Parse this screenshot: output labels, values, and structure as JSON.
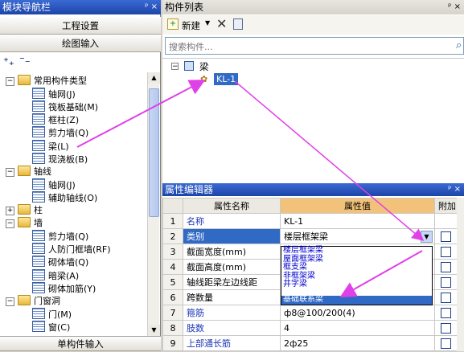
{
  "left_panel": {
    "title": "模块导航栏",
    "pin": "ᵖ ×",
    "btn_project": "工程设置",
    "btn_draw": "绘图输入",
    "btn_single": "单构件输入",
    "tree": [
      {
        "label": "常用构件类型",
        "level": 0
      },
      {
        "label": "轴网(J)",
        "level": 1
      },
      {
        "label": "筏板基础(M)",
        "level": 1
      },
      {
        "label": "框柱(Z)",
        "level": 1
      },
      {
        "label": "剪力墙(Q)",
        "level": 1
      },
      {
        "label": "梁(L)",
        "level": 1
      },
      {
        "label": "现浇板(B)",
        "level": 1
      },
      {
        "label": "轴线",
        "level": 0
      },
      {
        "label": "轴网(J)",
        "level": 1
      },
      {
        "label": "辅助轴线(O)",
        "level": 1
      },
      {
        "label": "柱",
        "level": 0
      },
      {
        "label": "墙",
        "level": 0
      },
      {
        "label": "剪力墙(Q)",
        "level": 1
      },
      {
        "label": "人防门框墙(RF)",
        "level": 1
      },
      {
        "label": "砌体墙(Q)",
        "level": 1
      },
      {
        "label": "暗梁(A)",
        "level": 1
      },
      {
        "label": "砌体加筋(Y)",
        "level": 1
      },
      {
        "label": "门窗洞",
        "level": 0
      },
      {
        "label": "门(M)",
        "level": 1
      },
      {
        "label": "窗(C)",
        "level": 1
      }
    ]
  },
  "component_list": {
    "title": "构件列表",
    "pin": "ᵖ ×",
    "new_label": "新建",
    "search_placeholder": "搜索构件...",
    "tree_root": "梁",
    "tree_child": "KL-1"
  },
  "property_editor": {
    "title": "属性编辑器",
    "pin": "ᵖ ×",
    "col_name": "属性名称",
    "col_value": "属性值",
    "col_extra": "附加",
    "rows": [
      {
        "n": "1",
        "name": "名称",
        "value": "KL-1",
        "blue": true
      },
      {
        "n": "2",
        "name": "类别",
        "value": "楼层框架梁",
        "blue": true
      },
      {
        "n": "3",
        "name": "截面宽度(mm)",
        "value": "",
        "blue": false
      },
      {
        "n": "4",
        "name": "截面高度(mm)",
        "value": "",
        "blue": false
      },
      {
        "n": "5",
        "name": "轴线距梁左边线距",
        "value": "",
        "blue": false
      },
      {
        "n": "6",
        "name": "跨数量",
        "value": "",
        "blue": false
      },
      {
        "n": "7",
        "name": "箍筋",
        "value": "ф8@100/200(4)",
        "blue": true
      },
      {
        "n": "8",
        "name": "肢数",
        "value": "4",
        "blue": true
      },
      {
        "n": "9",
        "name": "上部通长筋",
        "value": "2ф25",
        "blue": true
      }
    ],
    "dropdown_options": [
      "楼层框架梁",
      "屋面框架梁",
      "框支梁",
      "非框架梁",
      "井字梁",
      "基础联系梁"
    ],
    "dropdown_selected": "基础联系梁"
  },
  "colors": {
    "accent": "#e040e8",
    "title_blue": "#1c44a8",
    "selected": "#316ac5"
  }
}
